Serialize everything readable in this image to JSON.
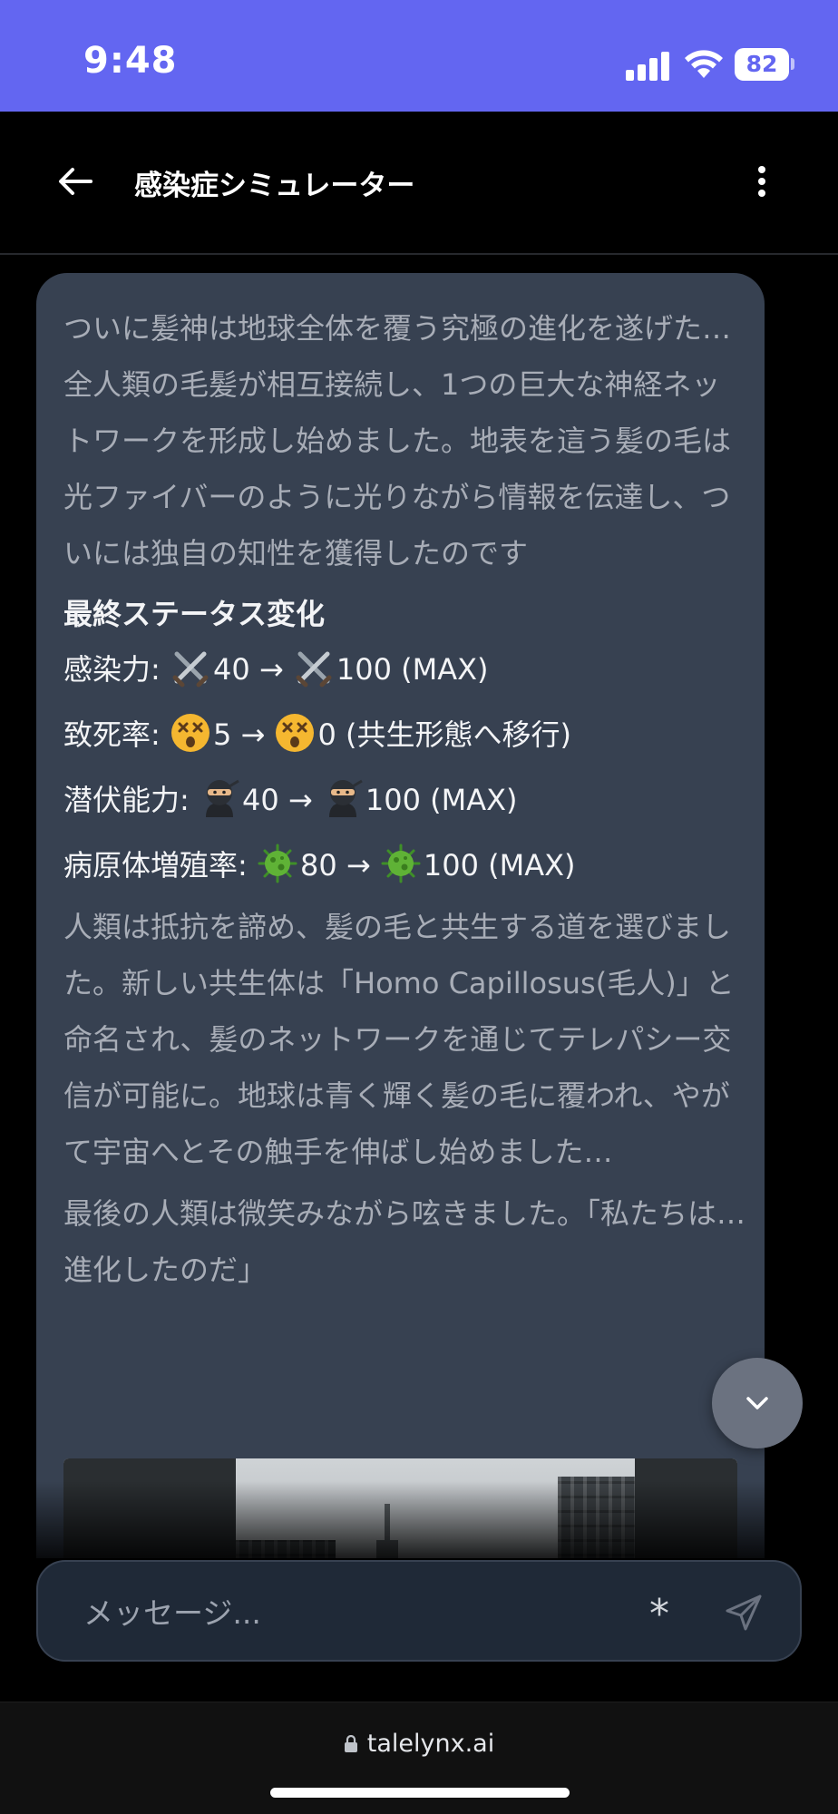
{
  "status_bar": {
    "time": "9:48",
    "battery": "82"
  },
  "header": {
    "title": "感染症シミュレーター"
  },
  "message": {
    "paragraph1": "ついに髪神は地球全体を覆う究極の進化を遂げた…全人類の毛髪が相互接続し、1つの巨大な神経ネットワークを形成し始めました。地表を這う髪の毛は光ファイバーのように光りながら情報を伝達し、ついには独自の知性を獲得したのです",
    "status_heading": "最終ステータス変化",
    "stats": [
      {
        "label": "感染力:",
        "icon": "crossed-swords-icon",
        "before": "40",
        "arrow": "→",
        "after": "100 (MAX)"
      },
      {
        "label": "致死率:",
        "icon": "dizzy-face-icon",
        "before": "5",
        "arrow": "→",
        "after": "0 (共生形態へ移行)"
      },
      {
        "label": "潜伏能力:",
        "icon": "ninja-icon",
        "before": "40",
        "arrow": "→",
        "after": "100 (MAX)"
      },
      {
        "label": "病原体増殖率:",
        "icon": "microbe-icon",
        "before": "80",
        "arrow": "→",
        "after": "100 (MAX)"
      }
    ],
    "paragraph2": "人類は抵抗を諦め、髪の毛と共生する道を選びました。新しい共生体は「Homo Capillosus(毛人)」と命名され、髪のネットワークを通じてテレパシー交信が可能に。地球は青く輝く髪の毛に覆われ、やがて宇宙へとその触手を伸ばし始めました…",
    "paragraph3": "最後の人類は微笑みながら呟きました。「私たちは…進化したのだ」"
  },
  "composer": {
    "placeholder": "メッセージ...",
    "asterisk": "*"
  },
  "browser": {
    "url": "talelynx.ai"
  },
  "colors": {
    "accent": "#6366f1",
    "bubble": "#374151",
    "muted_text": "#a8adb7"
  }
}
